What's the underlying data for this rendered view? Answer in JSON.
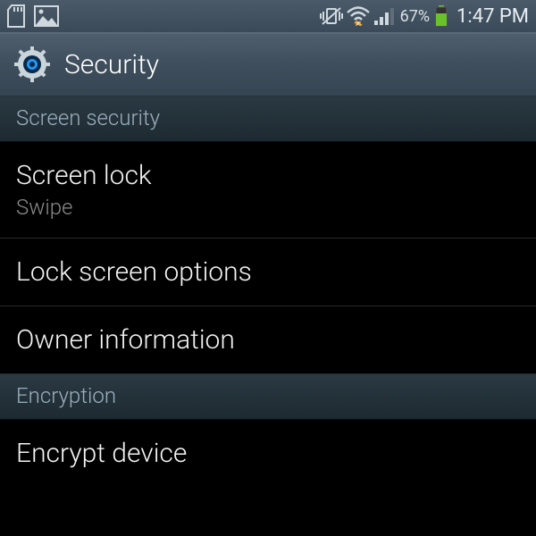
{
  "status": {
    "battery_pct": "67%",
    "time": "1:47 PM"
  },
  "header": {
    "title": "Security"
  },
  "sections": [
    {
      "label": "Screen security"
    },
    {
      "label": "Encryption"
    }
  ],
  "items": {
    "screen_lock": {
      "title": "Screen lock",
      "subtitle": "Swipe"
    },
    "lock_options": {
      "title": "Lock screen options"
    },
    "owner_info": {
      "title": "Owner information"
    },
    "encrypt_device": {
      "title": "Encrypt device"
    }
  }
}
